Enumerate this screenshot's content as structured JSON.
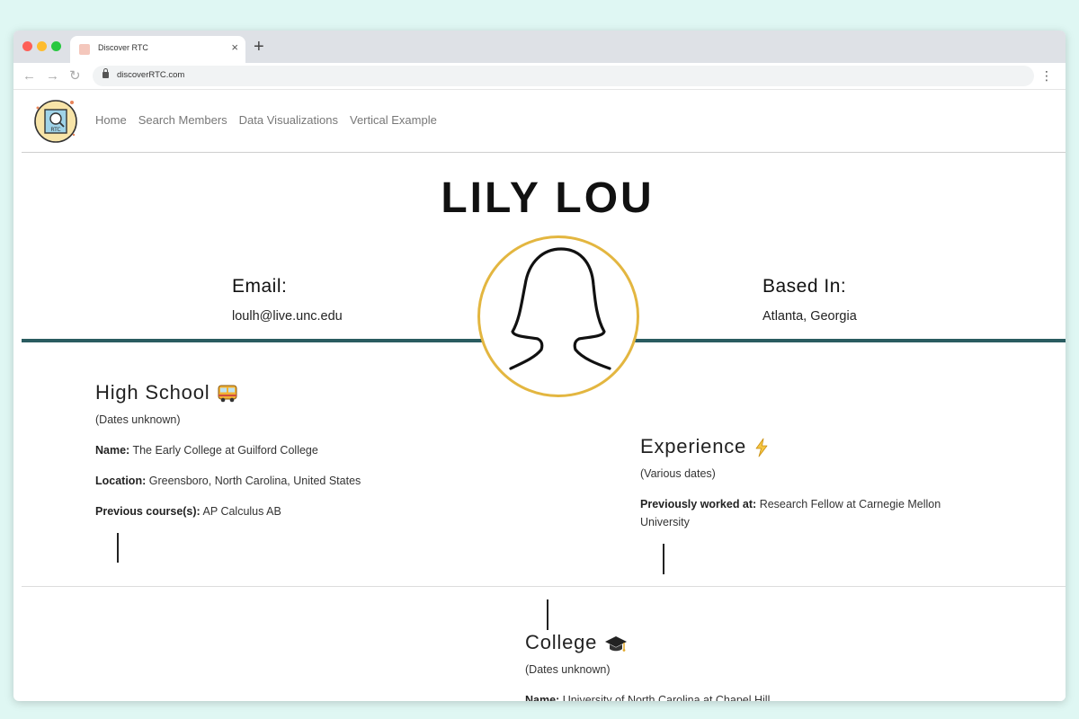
{
  "browser": {
    "tab_title": "Discover RTC",
    "url": "discoverRTC.com",
    "close_glyph": "×",
    "new_tab_glyph": "+",
    "back_glyph": "←",
    "forward_glyph": "→",
    "reload_glyph": "↻",
    "menu_glyph": "⋮"
  },
  "nav": {
    "logo_text": "RTC",
    "links": [
      "Home",
      "Search Members",
      "Data Visualizations",
      "Vertical Example"
    ]
  },
  "profile": {
    "name": "LILY LOU",
    "email_label": "Email:",
    "email": "loulh@live.unc.edu",
    "based_label": "Based In:",
    "based": "Atlanta, Georgia",
    "accent_color": "#e3b640",
    "rule_color": "#2a5c60"
  },
  "high_school": {
    "title": "High School",
    "icon": "bus-icon",
    "dates": "(Dates unknown)",
    "name_label": "Name:",
    "name": "The Early College at Guilford College",
    "location_label": "Location:",
    "location": "Greensboro, North Carolina, United States",
    "courses_label": "Previous course(s):",
    "courses": "AP Calculus AB"
  },
  "experience": {
    "title": "Experience",
    "icon": "lightning-icon",
    "dates": "(Various dates)",
    "worked_label": "Previously worked at:",
    "worked": "Research Fellow at Carnegie Mellon University"
  },
  "college": {
    "title": "College",
    "icon": "graduation-cap-icon",
    "dates": "(Dates unknown)",
    "name_label": "Name:",
    "name": "University of North Carolina at Chapel Hill"
  }
}
